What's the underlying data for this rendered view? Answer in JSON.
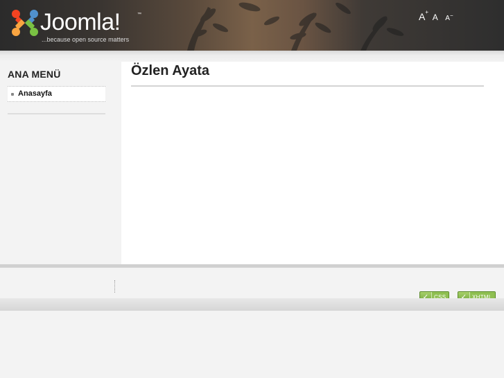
{
  "header": {
    "logo_word": "Joomla!",
    "logo_tm": "™",
    "tagline": "...because open source matters",
    "font_tools": {
      "increase": "A",
      "increase_mark": "+",
      "normal": "A",
      "decrease": "A",
      "decrease_mark": "−"
    }
  },
  "sidebar": {
    "menu_title": "ANA MENÜ",
    "items": [
      {
        "label": "Anasayfa"
      }
    ]
  },
  "main": {
    "title": "Özlen Ayata"
  },
  "footer": {
    "badges": [
      {
        "label": "CSS"
      },
      {
        "label": "XHTML"
      }
    ],
    "badge_color": "#7db241"
  },
  "colors": {
    "header_dark": "#2b2b2b",
    "background": "#f3f3f3",
    "content": "#ffffff"
  }
}
